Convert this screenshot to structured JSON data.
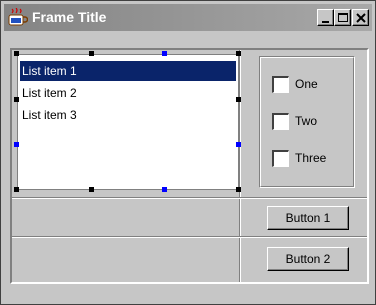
{
  "window": {
    "title": "Frame Title"
  },
  "titlebar_buttons": [
    {
      "name": "minimize-button",
      "icon": "minimize-icon"
    },
    {
      "name": "maximize-button",
      "icon": "maximize-icon"
    },
    {
      "name": "close-button",
      "icon": "close-icon"
    }
  ],
  "list": {
    "items": [
      "List item 1",
      "List item 2",
      "List item 3"
    ],
    "selected_index": 0
  },
  "checkboxes": [
    {
      "label": "One",
      "checked": false
    },
    {
      "label": "Two",
      "checked": false
    },
    {
      "label": "Three",
      "checked": false
    }
  ],
  "buttons": {
    "button1": "Button 1",
    "button2": "Button 2"
  },
  "colors": {
    "selection": "#0a246a",
    "handle_black": "#000000",
    "handle_blue": "#0000ff"
  }
}
